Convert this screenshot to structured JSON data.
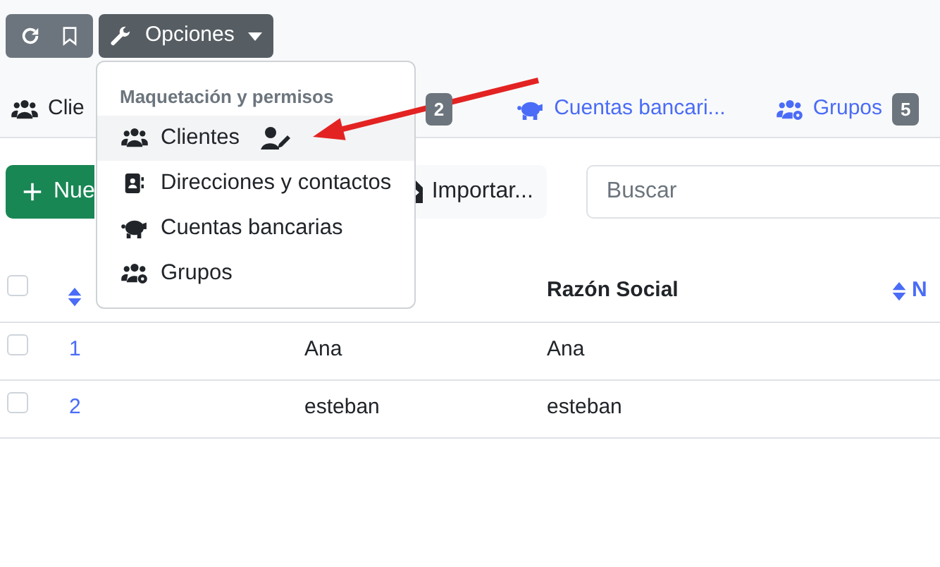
{
  "options_button": {
    "label": "Opciones"
  },
  "tabs": [
    {
      "label": "Clie",
      "selected": true
    },
    {
      "badge": "2",
      "selected": false
    },
    {
      "label": "Cuentas bancari...",
      "selected": false
    },
    {
      "label": "Grupos",
      "badge": "5",
      "selected": false
    }
  ],
  "actions": {
    "new_button": "Nue",
    "import_button": "Importar...",
    "search": {
      "placeholder": "Buscar"
    }
  },
  "table": {
    "all_checked": false,
    "columns": [
      {
        "sortable": true
      },
      {},
      {
        "label": "Razón Social",
        "sortable": false
      },
      {
        "label": "N",
        "sortable": true
      }
    ],
    "rows": [
      {
        "checked": false,
        "cells": [
          "1",
          "Ana",
          "Ana"
        ]
      },
      {
        "checked": false,
        "cells": [
          "2",
          "esteban",
          "esteban"
        ]
      }
    ]
  },
  "dropdown": {
    "header": "Maquetación y permisos",
    "items": [
      {
        "label": "Clientes",
        "selected": true,
        "editable": true
      },
      {
        "label": "Direcciones y contactos",
        "selected": false,
        "editable": false
      },
      {
        "label": "Cuentas bancarias",
        "selected": false,
        "editable": false
      },
      {
        "label": "Grupos",
        "selected": false,
        "editable": false
      }
    ]
  }
}
